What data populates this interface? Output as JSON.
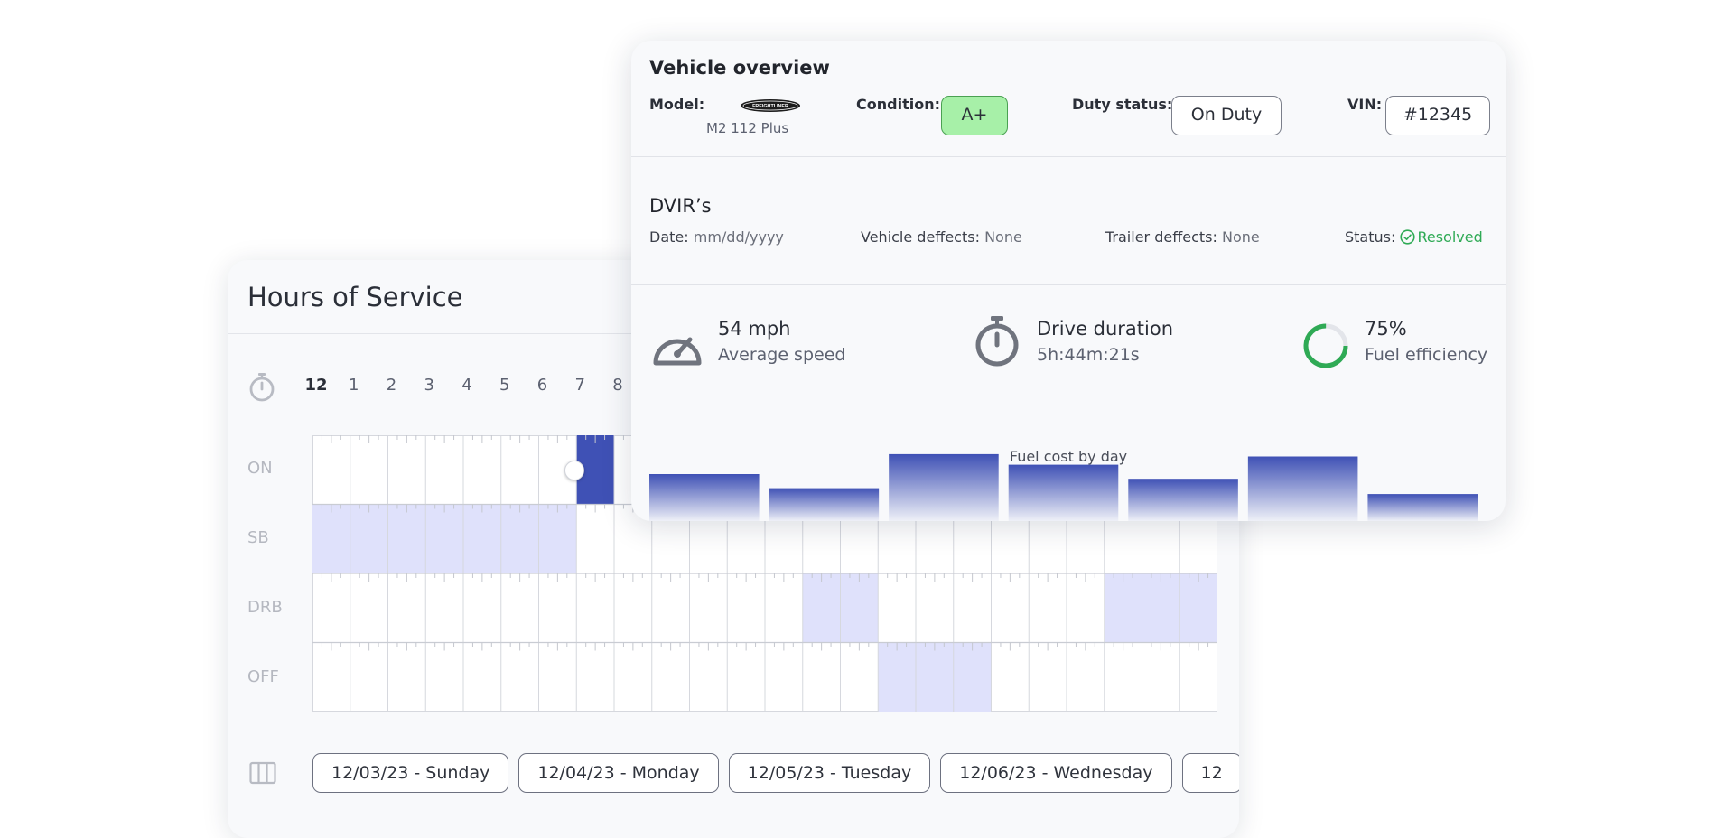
{
  "hos": {
    "title": "Hours of Service",
    "hours": [
      "12",
      "1",
      "2",
      "3",
      "4",
      "5",
      "6",
      "7",
      "8"
    ],
    "rows": [
      "ON",
      "SB",
      "DRB",
      "OFF"
    ],
    "shading": {
      "ON_active_dark": [
        7,
        8
      ],
      "SB": [
        0,
        7
      ],
      "DRB": [
        [
          13,
          15
        ],
        [
          21,
          24
        ]
      ],
      "OFF": [
        [
          15,
          18
        ]
      ]
    },
    "dates": [
      "12/03/23 - Sunday",
      "12/04/23 - Monday",
      "12/05/23 - Tuesday",
      "12/06/23 - Wednesday",
      "12"
    ],
    "colors": {
      "active": "#3f51b5",
      "shade": "#dfe1fb",
      "grid": "#d6d8de"
    }
  },
  "vehicle": {
    "title": "Vehicle overview",
    "model_label": "Model:",
    "model_brand": "FREIGHTLINER",
    "model_name": "M2 112 Plus",
    "condition_label": "Condition:",
    "condition_value": "A+",
    "duty_label": "Duty status:",
    "duty_value": "On Duty",
    "vin_label": "VIN:",
    "vin_value": "#12345"
  },
  "dvir": {
    "title": "DVIR’s",
    "date_label": "Date:",
    "date_value": "mm/dd/yyyy",
    "vehicle_defects_label": "Vehicle deffects:",
    "vehicle_defects_value": "None",
    "trailer_defects_label": "Trailer deffects:",
    "trailer_defects_value": "None",
    "status_label": "Status:",
    "status_value": "Resolved"
  },
  "stats": {
    "speed_value": "54 mph",
    "speed_label": "Average speed",
    "duration_value": "Drive duration",
    "duration_label": "5h:44m:21s",
    "fuel_value": "75%",
    "fuel_label": "Fuel efficiency",
    "fuel_fraction": 0.75
  },
  "chart_data": {
    "type": "bar",
    "title": "Fuel cost by day",
    "categories": [
      "",
      "",
      "",
      "",
      "",
      "",
      ""
    ],
    "values": [
      40,
      28,
      57,
      48,
      36,
      55,
      23
    ],
    "ylim": [
      0,
      60
    ],
    "color": "#3f51b5"
  }
}
